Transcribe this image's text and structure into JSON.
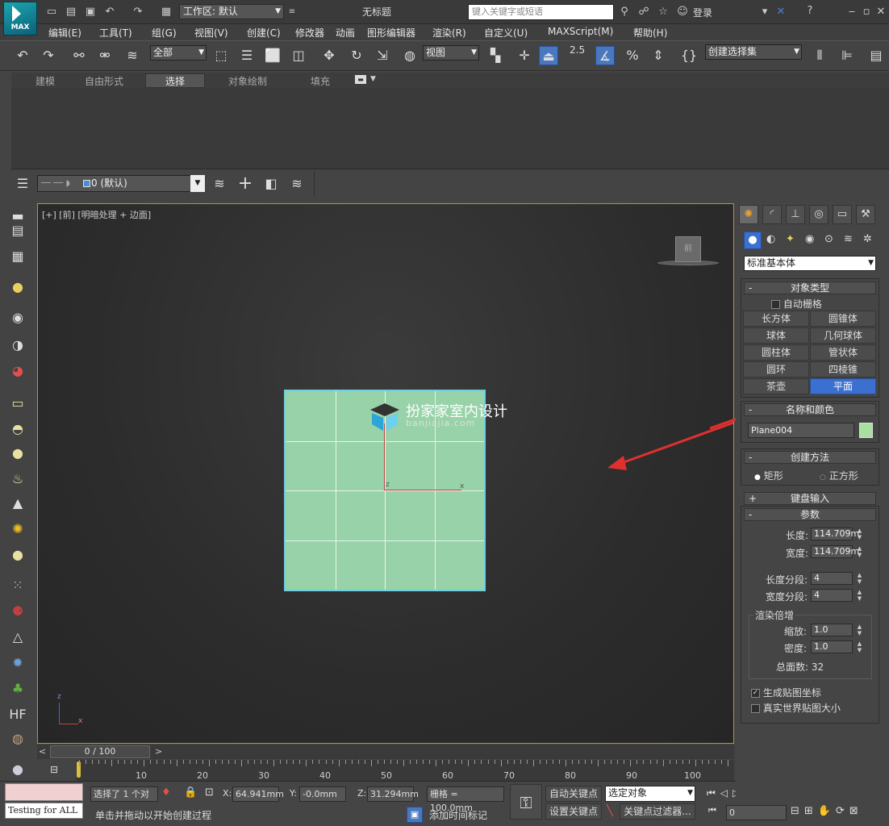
{
  "titlebar": {
    "logo": "MAX",
    "workspace": "工作区: 默认",
    "doc_title": "无标题",
    "search_placeholder": "键入关键字或短语",
    "login": "登录"
  },
  "menu": [
    "编辑(E)",
    "工具(T)",
    "组(G)",
    "视图(V)",
    "创建(C)",
    "修改器",
    "动画",
    "图形编辑器",
    "渲染(R)",
    "自定义(U)",
    "MAXScript(M)",
    "帮助(H)"
  ],
  "toolbar": {
    "filter": "全部",
    "refcoord": "视图",
    "snap_angle": "2.5",
    "named_selection": "创建选择集"
  },
  "ribbon": {
    "tabs": [
      "建模",
      "自由形式",
      "选择",
      "对象绘制",
      "填充"
    ],
    "active_tab": "选择"
  },
  "layer": {
    "current": "0 (默认)"
  },
  "viewport": {
    "label": "[+] [前] [明暗处理 + 边面]",
    "viewcube_label": "前",
    "watermark_title": "扮家家室内设计",
    "watermark_sub": "banjiajia.com",
    "axis_z": "z",
    "axis_x": "x",
    "plane_color": "#98d2a8",
    "grid_rows": 4,
    "grid_cols": 4
  },
  "timeline": {
    "position": "0 / 100",
    "ticks": [
      "10",
      "20",
      "30",
      "40",
      "50",
      "60",
      "70",
      "80",
      "90",
      "100"
    ]
  },
  "status": {
    "message": "Testing for ALL",
    "selected": "选择了 1 个对",
    "hint": "单击并拖动以开始创建过程",
    "x_label": "X:",
    "x": "64.941mm",
    "y_label": "Y:",
    "y": "-0.0mm",
    "z_label": "Z:",
    "z": "31.294mm",
    "grid": "栅格 = 100.0mm",
    "add_time_tag": "添加时间标记",
    "auto_key": "自动关键点",
    "set_key": "设置关键点",
    "key_mode": "选定对象",
    "key_filters": "关键点过滤器...",
    "frame": "0"
  },
  "cmdpanel": {
    "category": "标准基本体",
    "object_type": {
      "title": "对象类型",
      "autogrid": "自动栅格",
      "buttons": [
        "长方体",
        "圆锥体",
        "球体",
        "几何球体",
        "圆柱体",
        "管状体",
        "圆环",
        "四棱锥",
        "茶壶",
        "平面"
      ],
      "selected": "平面"
    },
    "name_color": {
      "title": "名称和颜色",
      "name": "Plane004",
      "color": "#a8e0a0"
    },
    "creation_method": {
      "title": "创建方法",
      "rect": "矩形",
      "square": "正方形"
    },
    "keyboard_entry": {
      "title": "键盘输入"
    },
    "params": {
      "title": "参数",
      "length_label": "长度:",
      "length": "114.709m",
      "width_label": "宽度:",
      "width": "114.709m",
      "len_segs_label": "长度分段:",
      "len_segs": "4",
      "wid_segs_label": "宽度分段:",
      "wid_segs": "4",
      "render_mult": "渲染倍增",
      "scale_label": "缩放:",
      "scale": "1.0",
      "density_label": "密度:",
      "density": "1.0",
      "total_faces": "总面数: 32",
      "gen_map": "生成贴图坐标",
      "real_world": "真实世界贴图大小"
    }
  }
}
